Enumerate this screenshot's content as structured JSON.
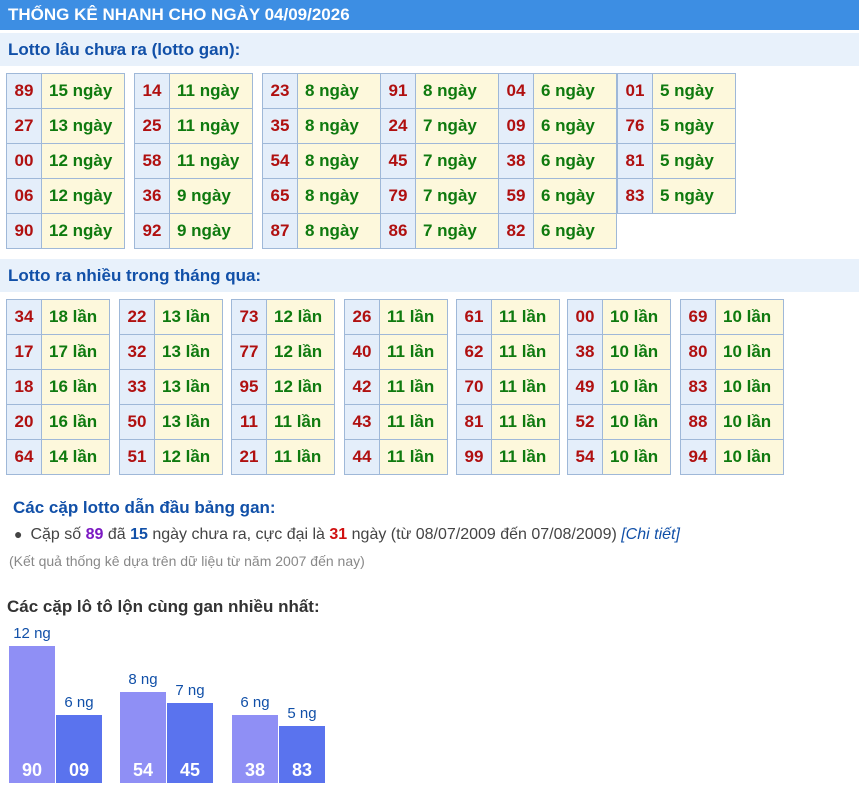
{
  "title": "THỐNG KÊ NHANH CHO NGÀY 04/09/2026",
  "gan": {
    "heading": "Lotto lâu chưa ra (lotto gan):",
    "columns": [
      [
        [
          "89",
          "15 ngày"
        ],
        [
          "27",
          "13 ngày"
        ],
        [
          "00",
          "12 ngày"
        ],
        [
          "06",
          "12 ngày"
        ],
        [
          "90",
          "12 ngày"
        ]
      ],
      [
        [
          "14",
          "11 ngày"
        ],
        [
          "25",
          "11 ngày"
        ],
        [
          "58",
          "11 ngày"
        ],
        [
          "36",
          "9 ngày"
        ],
        [
          "92",
          "9 ngày"
        ]
      ],
      [
        [
          "23",
          "8 ngày"
        ],
        [
          "35",
          "8 ngày"
        ],
        [
          "54",
          "8 ngày"
        ],
        [
          "65",
          "8 ngày"
        ],
        [
          "87",
          "8 ngày"
        ]
      ],
      [
        [
          "91",
          "8 ngày"
        ],
        [
          "24",
          "7 ngày"
        ],
        [
          "45",
          "7 ngày"
        ],
        [
          "79",
          "7 ngày"
        ],
        [
          "86",
          "7 ngày"
        ]
      ],
      [
        [
          "04",
          "6 ngày"
        ],
        [
          "09",
          "6 ngày"
        ],
        [
          "38",
          "6 ngày"
        ],
        [
          "59",
          "6 ngày"
        ],
        [
          "82",
          "6 ngày"
        ]
      ],
      [
        [
          "01",
          "5 ngày"
        ],
        [
          "76",
          "5 ngày"
        ],
        [
          "81",
          "5 ngày"
        ],
        [
          "83",
          "5 ngày"
        ]
      ]
    ]
  },
  "freq": {
    "heading": "Lotto ra nhiều trong tháng qua:",
    "columns": [
      [
        [
          "34",
          "18 lần"
        ],
        [
          "17",
          "17 lần"
        ],
        [
          "18",
          "16 lần"
        ],
        [
          "20",
          "16 lần"
        ],
        [
          "64",
          "14 lần"
        ]
      ],
      [
        [
          "22",
          "13 lần"
        ],
        [
          "32",
          "13 lần"
        ],
        [
          "33",
          "13 lần"
        ],
        [
          "50",
          "13 lần"
        ],
        [
          "51",
          "12 lần"
        ]
      ],
      [
        [
          "73",
          "12 lần"
        ],
        [
          "77",
          "12 lần"
        ],
        [
          "95",
          "12 lần"
        ],
        [
          "11",
          "11 lần"
        ],
        [
          "21",
          "11 lần"
        ]
      ],
      [
        [
          "26",
          "11 lần"
        ],
        [
          "40",
          "11 lần"
        ],
        [
          "42",
          "11 lần"
        ],
        [
          "43",
          "11 lần"
        ],
        [
          "44",
          "11 lần"
        ]
      ],
      [
        [
          "61",
          "11 lần"
        ],
        [
          "62",
          "11 lần"
        ],
        [
          "70",
          "11 lần"
        ],
        [
          "81",
          "11 lần"
        ],
        [
          "99",
          "11 lần"
        ]
      ],
      [
        [
          "00",
          "10 lần"
        ],
        [
          "38",
          "10 lần"
        ],
        [
          "49",
          "10 lần"
        ],
        [
          "52",
          "10 lần"
        ],
        [
          "54",
          "10 lần"
        ]
      ],
      [
        [
          "69",
          "10 lần"
        ],
        [
          "80",
          "10 lần"
        ],
        [
          "83",
          "10 lần"
        ],
        [
          "88",
          "10 lần"
        ],
        [
          "94",
          "10 lần"
        ]
      ]
    ]
  },
  "leader": {
    "heading": "Các cặp lotto dẫn đầu bảng gan:",
    "t1": "Cặp số ",
    "pair": "89",
    "t2": " đã ",
    "days": "15",
    "t3": " ngày chưa ra, cực đại là ",
    "max": "31",
    "t4": " ngày (từ 08/07/2009 đến 07/08/2009) ",
    "link": "[Chi tiết]",
    "note": "(Kết quả thống kê dựa trên dữ liệu từ năm 2007 đến nay)"
  },
  "chart_heading": "Các cặp lô tô lộn cùng gan nhiều nhất:",
  "chart_data": {
    "type": "bar",
    "unit_suffix": " ng",
    "colors": {
      "first": "#8f8ff5",
      "second": "#5a73ee"
    },
    "groups": [
      {
        "bars": [
          {
            "label": "90",
            "value": 12
          },
          {
            "label": "09",
            "value": 6
          }
        ]
      },
      {
        "bars": [
          {
            "label": "54",
            "value": 8
          },
          {
            "label": "45",
            "value": 7
          }
        ]
      },
      {
        "bars": [
          {
            "label": "38",
            "value": 6
          },
          {
            "label": "83",
            "value": 5
          }
        ]
      }
    ]
  }
}
